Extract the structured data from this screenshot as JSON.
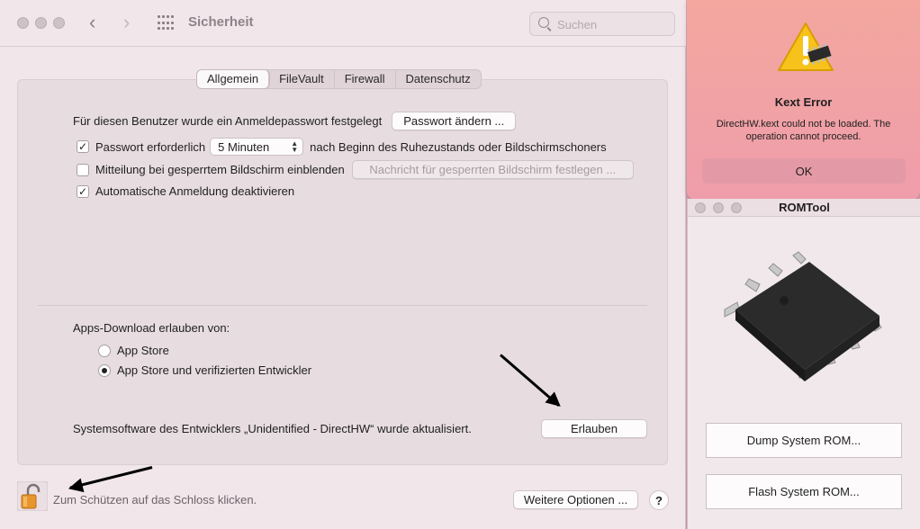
{
  "main_window": {
    "title": "Sicherheit",
    "search_placeholder": "Suchen",
    "tabs": [
      "Allgemein",
      "FileVault",
      "Firewall",
      "Datenschutz"
    ],
    "active_tab": "Allgemein",
    "password_set_text": "Für diesen Benutzer wurde ein Anmeldepasswort festgelegt",
    "change_password_button": "Passwort ändern ...",
    "require_password_label": "Passwort erforderlich",
    "require_password_checked": true,
    "require_password_delay": "5 Minuten",
    "require_password_suffix": "nach Beginn des Ruhezustands oder Bildschirmschoners",
    "show_message_label": "Mitteilung bei gesperrtem Bildschirm einblenden",
    "show_message_checked": false,
    "set_message_button": "Nachricht für gesperrten Bildschirm festlegen ...",
    "disable_autologin_label": "Automatische Anmeldung deaktivieren",
    "disable_autologin_checked": true,
    "apps_download_label": "Apps-Download erlauben von:",
    "radio_app_store": "App Store",
    "radio_app_store_devs": "App Store und verifizierten Entwickler",
    "selected_radio": "App Store und verifizierten Entwickler",
    "system_software_text": "Systemsoftware des Entwicklers „Unidentified - DirectHW“ wurde aktualisiert.",
    "allow_button": "Erlauben",
    "lock_text": "Zum Schützen auf das Schloss klicken.",
    "more_options_button": "Weitere Optionen ...",
    "help_button": "?"
  },
  "alert": {
    "title": "Kext Error",
    "message": "DirectHW.kext could not be loaded. The operation cannot proceed.",
    "ok_button": "OK"
  },
  "romtool": {
    "title": "ROMTool",
    "dump_button": "Dump System ROM...",
    "flash_button": "Flash System ROM..."
  },
  "colors": {
    "alert_background": "#f3a79e",
    "window_background": "#f1e6ea",
    "lock_orange": "#e8962c"
  }
}
